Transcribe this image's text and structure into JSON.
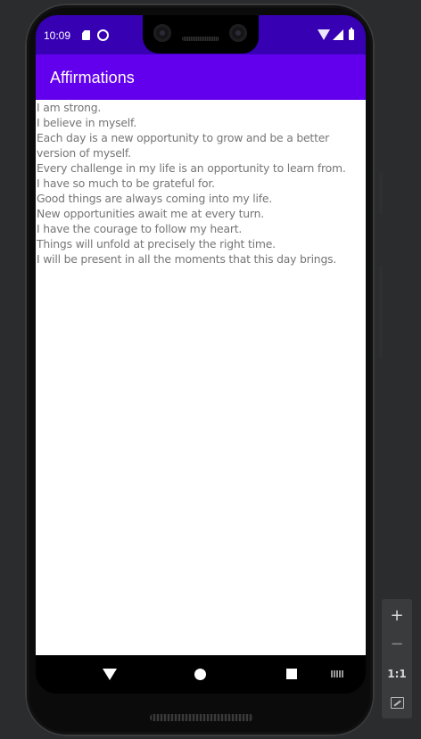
{
  "status_bar": {
    "time": "10:09",
    "icons": [
      "sd-card-icon",
      "sync-icon",
      "wifi-icon",
      "signal-icon",
      "battery-icon"
    ]
  },
  "app_bar": {
    "title": "Affirmations"
  },
  "affirmations": [
    "I am strong.",
    "I believe in myself.",
    "Each day is a new opportunity to grow and be a better version of myself.",
    "Every challenge in my life is an opportunity to learn from.",
    "I have so much to be grateful for.",
    "Good things are always coming into my life.",
    "New opportunities await me at every turn.",
    "I have the courage to follow my heart.",
    "Things will unfold at precisely the right time.",
    "I will be present in all the moments that this day brings."
  ],
  "nav_bar": {
    "icons": [
      "back-icon",
      "home-icon",
      "recents-icon",
      "keyboard-icon"
    ]
  },
  "emulator_zoom": {
    "zoom_in": "+",
    "zoom_out": "−",
    "actual_size": "1:1"
  },
  "colors": {
    "status_bar": "#3700b3",
    "app_bar": "#6200ee",
    "text": "#757575"
  }
}
